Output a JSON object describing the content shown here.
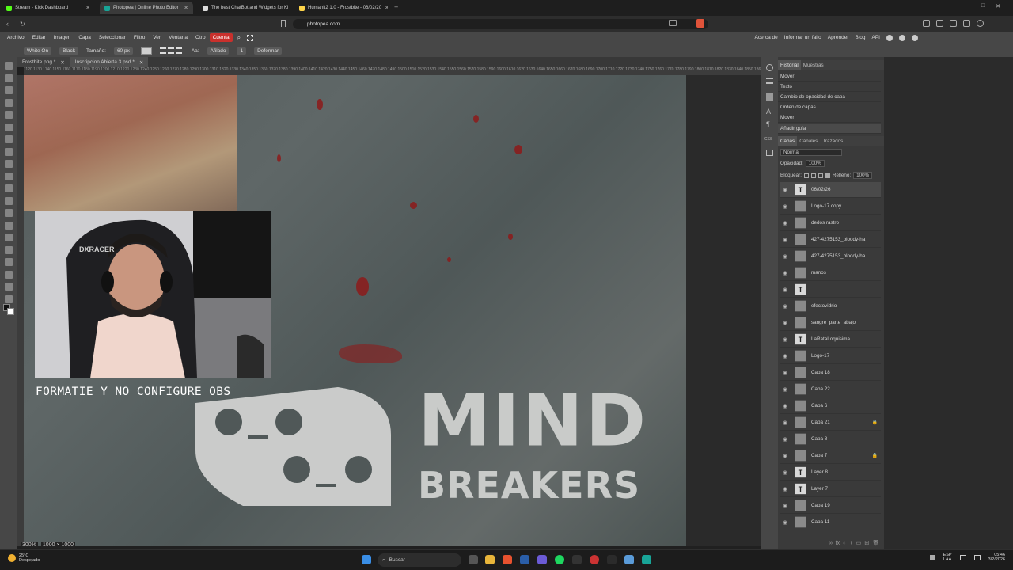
{
  "browser": {
    "tabs": [
      {
        "title": "Stream - Kick Dashboard",
        "color": "#53fc18"
      },
      {
        "title": "Photopea | Online Photo Editor",
        "color": "#18a497"
      },
      {
        "title": "The best ChatBot and Widgets for Ki",
        "color": "#dddddd"
      },
      {
        "title": "Humanit2 1.0 - Frostbite - 06/02/20",
        "color": "#ffd54a"
      }
    ],
    "url": "photopea.com",
    "window_controls": [
      "–",
      "□",
      "✕"
    ]
  },
  "menu": {
    "items": [
      "Archivo",
      "Editar",
      "Imagen",
      "Capa",
      "Seleccionar",
      "Filtro",
      "Ver",
      "Ventana",
      "Otro",
      "Cuenta"
    ],
    "right_links": [
      "Acerca de",
      "Informar un fallo",
      "Aprender",
      "Blog",
      "API"
    ]
  },
  "options": {
    "font": "White On",
    "style": "Black",
    "size_label": "Tamaño:",
    "size_value": "60 px",
    "aa_label": "Aa:",
    "aa_value": "Afilado",
    "tracking_value": "1",
    "warp_label": "Deformar"
  },
  "documents": [
    {
      "name": "Frostbite.png *"
    },
    {
      "name": "Inscripcion Abierta 3.psd *"
    }
  ],
  "ruler": "1120 1130 1140 1150 1160 1170 1180 1190 1200 1210 1220 1230 1240 1250 1260 1270 1280 1290 1300 1310 1320 1330 1340 1350 1360 1370 1380 1390 1400 1410 1420 1430 1440 1450 1460 1470 1480 1490 1500 1510 1520 1530 1540 1550 1560 1570 1580 1590 1600 1610 1620 1630 1640 1650 1660 1670 1680 1690 1700 1710 1720 1730 1740 1750 1760 1770 1780 1790 1800 1810 1820 1830 1840 1850 1860 1870 1880 1890 1900 1910 1920",
  "canvas": {
    "overlay_text": "FORMATIE Y NO CONFIGURE OBS",
    "logo_line1": "MIND",
    "logo_line2": "BREAKERS"
  },
  "status": {
    "zoom": "300%",
    "dimensions": "1000 × 1000"
  },
  "panels": {
    "history_tabs": [
      "Historial",
      "Muestras"
    ],
    "history_items": [
      "Mover",
      "Texto",
      "Cambio de opacidad de capa",
      "Orden de capas",
      "Mover",
      "Añadir guía"
    ],
    "layer_tabs": [
      "Capas",
      "Canales",
      "Trazados"
    ],
    "blend_mode": "Normal",
    "opacity_label": "Opacidad:",
    "opacity_value": "100%",
    "lock_label": "Bloquear:",
    "fill_label": "Relleno:",
    "fill_value": "100%",
    "layers": [
      {
        "name": "06/02/26",
        "type": "text",
        "selected": true,
        "locked": false
      },
      {
        "name": "Logo-17 copy",
        "type": "image",
        "locked": false
      },
      {
        "name": "dedos rastro",
        "type": "image",
        "locked": false
      },
      {
        "name": "427-4275153_bloody-ha",
        "type": "image",
        "locked": false
      },
      {
        "name": "427-4275153_bloody-ha",
        "type": "image",
        "locked": false
      },
      {
        "name": "manos",
        "type": "image",
        "locked": false
      },
      {
        "name": "",
        "type": "text",
        "locked": false
      },
      {
        "name": "efectovidrio",
        "type": "image",
        "locked": false
      },
      {
        "name": "sangre_parte_abajo",
        "type": "image",
        "locked": false
      },
      {
        "name": "LaRataLoquisima",
        "type": "text",
        "locked": false
      },
      {
        "name": "Logo-17",
        "type": "image",
        "locked": false
      },
      {
        "name": "Capa 18",
        "type": "image",
        "locked": false
      },
      {
        "name": "Capa 22",
        "type": "image",
        "locked": false
      },
      {
        "name": "Capa 6",
        "type": "image",
        "locked": false
      },
      {
        "name": "Capa 21",
        "type": "image",
        "locked": true
      },
      {
        "name": "Capa 8",
        "type": "image",
        "locked": false
      },
      {
        "name": "Capa 7",
        "type": "image",
        "locked": true
      },
      {
        "name": "Layer 8",
        "type": "text",
        "locked": false
      },
      {
        "name": "Layer 7",
        "type": "text",
        "locked": false
      },
      {
        "name": "Capa 19",
        "type": "image",
        "locked": false
      },
      {
        "name": "Capa 11",
        "type": "image",
        "locked": false
      }
    ]
  },
  "taskbar": {
    "temp": "25°C",
    "weather": "Despejado",
    "search_placeholder": "Buscar",
    "lang": "ESP",
    "lang2": "LAA",
    "time": "05:46",
    "date": "3/2/2026"
  }
}
